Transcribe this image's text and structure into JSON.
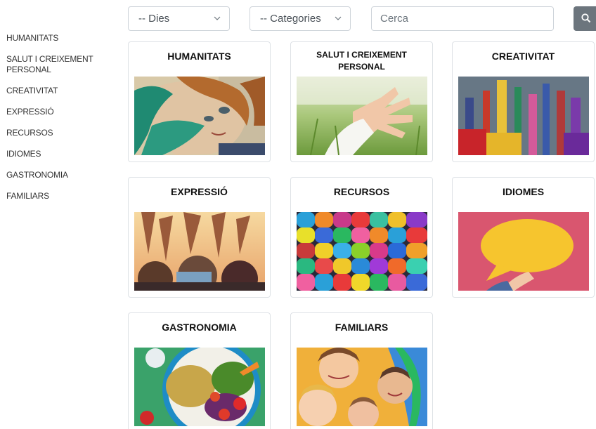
{
  "sidebar": {
    "items": [
      {
        "label": "HUMANITATS"
      },
      {
        "label": "SALUT I CREIXEMENT PERSONAL"
      },
      {
        "label": "CREATIVITAT"
      },
      {
        "label": "EXPRESSIÓ"
      },
      {
        "label": "RECURSOS"
      },
      {
        "label": "IDIOMES"
      },
      {
        "label": "GASTRONOMIA"
      },
      {
        "label": "FAMILIARS"
      }
    ],
    "salut_line1": "SALUT I CREIXEMENT",
    "salut_line2": "PERSONAL"
  },
  "filters": {
    "days": "-- Dies",
    "categories": "-- Categories",
    "search_placeholder": "Cerca",
    "search_icon": "search-icon"
  },
  "cards": [
    {
      "title": "HUMANITATS",
      "image": "painting-portrait-image"
    },
    {
      "title": "SALUT I CREIXEMENT PERSONAL",
      "image": "hand-in-field-image"
    },
    {
      "title": "CREATIVITAT",
      "image": "paint-brushes-image"
    },
    {
      "title": "EXPRESSIÓ",
      "image": "raised-hands-image"
    },
    {
      "title": "RECURSOS",
      "image": "colorful-wool-image"
    },
    {
      "title": "IDIOMES",
      "image": "speech-bubble-image"
    },
    {
      "title": "GASTRONOMIA",
      "image": "salad-plate-image"
    },
    {
      "title": "FAMILIARS",
      "image": "children-faces-image"
    }
  ],
  "colors": {
    "border": "#dee2e6",
    "button": "#6c757d",
    "text": "#333333"
  }
}
